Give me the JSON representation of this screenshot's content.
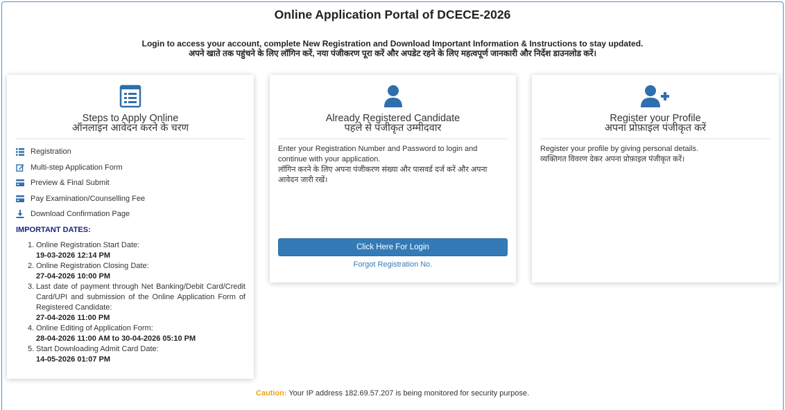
{
  "header": {
    "title": "Online Application Portal of DCECE-2026",
    "intro_en": "Login to access your account, complete New Registration and Download Important Information & Instructions to stay updated.",
    "intro_hi": "अपने खाते तक पहुंचने के लिए लॉगिन करें, नया पंजीकरण पूरा करें और अपडेट रहने के लिए महत्वपूर्ण जानकारी और निर्देश डाउनलोड करें।"
  },
  "steps_card": {
    "icon": "form-list-icon",
    "title_en": "Steps to Apply Online",
    "title_hi": "ऑनलाइन आवेदन करने के चरण",
    "steps": [
      {
        "icon": "list-icon",
        "label": "Registration"
      },
      {
        "icon": "edit-icon",
        "label": "Multi-step Application Form"
      },
      {
        "icon": "card-icon",
        "label": "Preview & Final Submit"
      },
      {
        "icon": "card-icon",
        "label": "Pay Examination/Counselling Fee"
      },
      {
        "icon": "download-icon",
        "label": "Download Confirmation Page"
      }
    ],
    "important_heading": "IMPORTANT DATES:",
    "dates": [
      {
        "num": "1.",
        "label": "Online Registration Start Date:",
        "value": "19-03-2026 12:14 PM"
      },
      {
        "num": "2.",
        "label": "Online Registration Closing Date:",
        "value": "27-04-2026 10:00 PM"
      },
      {
        "num": "3.",
        "label": "Last date of payment through Net Banking/Debit Card/Credit Card/UPI and submission of the Online Application Form of Registered Candidate:",
        "value": "27-04-2026 11:00 PM"
      },
      {
        "num": "4.",
        "label": "Online Editing of Application Form:",
        "value": "28-04-2026 11:00 AM to 30-04-2026 05:10 PM"
      },
      {
        "num": "5.",
        "label": "Start Downloading Admit Card Date:",
        "value": "14-05-2026 01:07 PM"
      }
    ]
  },
  "login_card": {
    "icon": "user-icon",
    "title_en": "Already Registered Candidate",
    "title_hi": "पहले से पंजीकृत उम्मीदवार",
    "text_en": "Enter your Registration Number and Password to login and continue with your application.",
    "text_hi": "लॉगिन करने के लिए अपना पंजीकरण संख्या और पासवर्ड दर्ज करें और अपना आवेदन जारी रखें।",
    "button_label": "Click Here For Login",
    "forgot_label": "Forgot Registration No."
  },
  "register_card": {
    "icon": "user-plus-icon",
    "title_en": "Register your Profile",
    "title_hi": "अपना प्रोफ़ाइल पंजीकृत करें",
    "text_en": "Register your profile by giving personal details.",
    "text_hi": "व्यक्तिगत विवरण देकर अपना प्रोफ़ाइल पंजीकृत करें।"
  },
  "footer": {
    "caution_label": "Caution:",
    "caution_text": "Your IP address 182.69.57.207 is being monitored for security purpose."
  },
  "colors": {
    "accent": "#337ab7",
    "heading_navy": "#1a237e",
    "caution": "#f0a31c",
    "icon_blue": "#2f6fad"
  }
}
